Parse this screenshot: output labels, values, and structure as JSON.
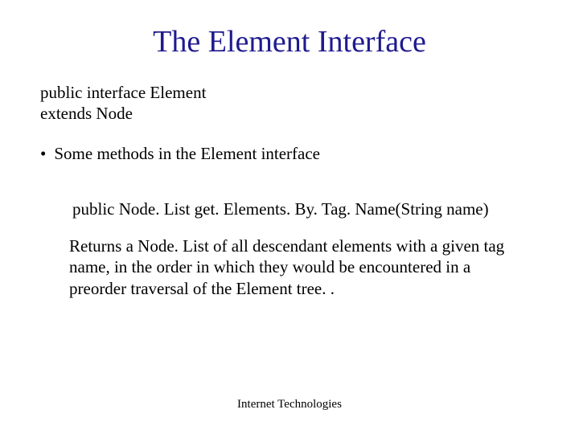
{
  "title": "The Element Interface",
  "declaration_line1": "public interface Element",
  "declaration_line2": "extends Node",
  "bullet": "Some methods in the Element interface",
  "method_signature": "public Node. List get. Elements. By. Tag. Name(String name)",
  "description": "Returns a Node. List of all descendant elements with a given tag name, in the order in which they would be encountered in a preorder traversal of the Element tree. .",
  "footer": "Internet Technologies"
}
